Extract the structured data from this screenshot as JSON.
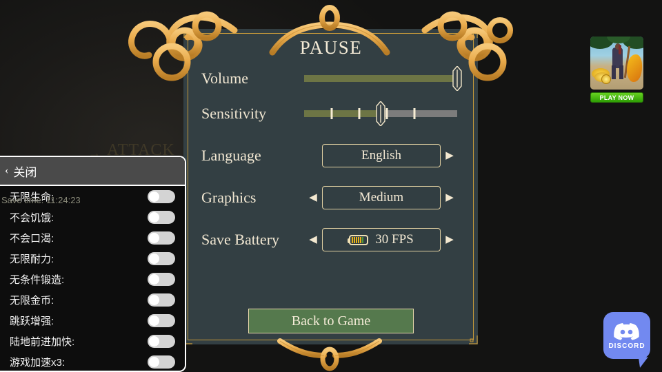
{
  "background": {
    "attack_hint": "ATTACK",
    "arrow_icon": "→",
    "watermark": ""
  },
  "pause_menu": {
    "title": "PAUSE",
    "back_button": "Back to Game",
    "options": [
      {
        "label": "Volume",
        "type": "slider",
        "value": 100
      },
      {
        "label": "Sensitivity",
        "type": "slider",
        "value": 50,
        "ticks": [
          18,
          36,
          54,
          72
        ]
      },
      {
        "label": "Language",
        "type": "selector",
        "value": "English",
        "left_arrow": "",
        "right_arrow": "▶"
      },
      {
        "label": "Graphics",
        "type": "selector",
        "value": "Medium",
        "left_arrow": "◀",
        "right_arrow": "▶"
      },
      {
        "label": "Save Battery",
        "type": "selector",
        "value": "30 FPS",
        "left_arrow": "◀",
        "right_arrow": "▶",
        "icon": "battery-icon"
      }
    ]
  },
  "cheat_menu": {
    "header": {
      "back_icon": "‹",
      "title": "关闭"
    },
    "rows": [
      {
        "label": "无限生命:",
        "enabled": false
      },
      {
        "label": "不会饥饿:",
        "enabled": false
      },
      {
        "label": "不会口渴:",
        "enabled": false
      },
      {
        "label": "无限耐力:",
        "enabled": false
      },
      {
        "label": "无条件锻造:",
        "enabled": false
      },
      {
        "label": "无限金币:",
        "enabled": false
      },
      {
        "label": "跳跃增强:",
        "enabled": false
      },
      {
        "label": "陆地前进加快:",
        "enabled": false
      },
      {
        "label": "游戏加速x3:",
        "enabled": false
      }
    ]
  },
  "save_time": "Save time: 11:24:23",
  "ad": {
    "play_label": "PLAY NOW"
  },
  "discord": {
    "label": "DISCORD"
  },
  "colors": {
    "panel_bg": "#333f43",
    "gold_frame": "#c79a3a",
    "cream_text": "#f3e9d4",
    "slider_fill": "#6d7545",
    "slider_track": "#7c7c7c",
    "button_green": "#55794d",
    "rope": "#e8ae54",
    "discord_blue": "#7289f0",
    "play_green": "#4bb80f"
  }
}
